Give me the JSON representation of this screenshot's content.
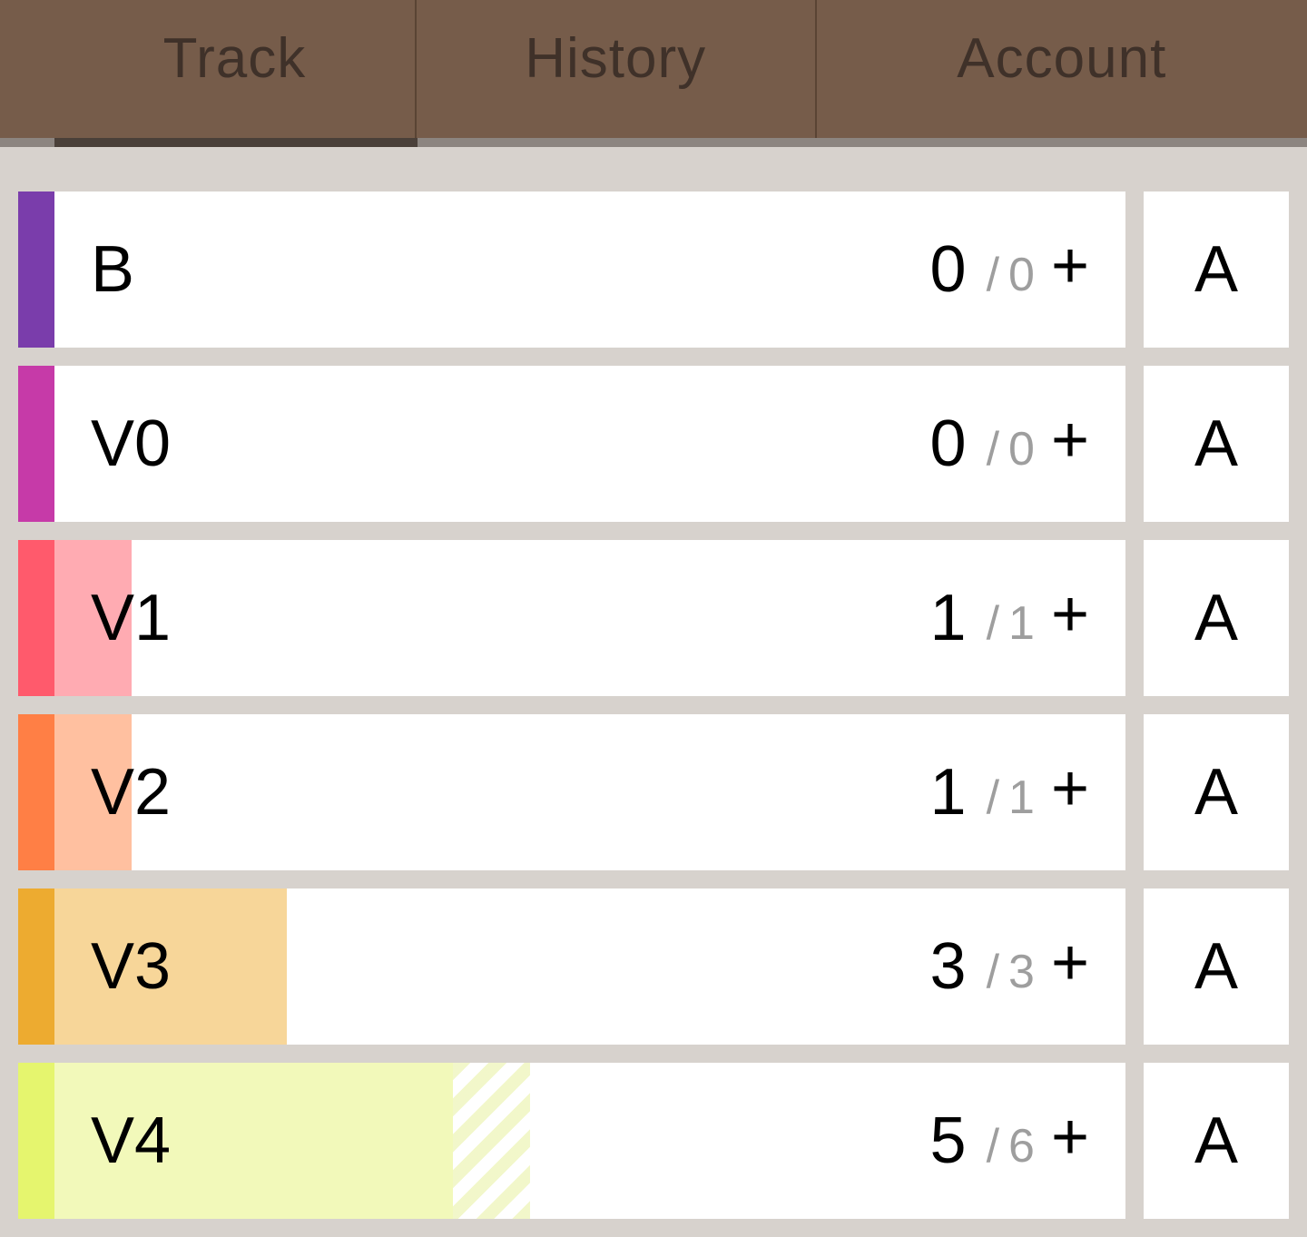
{
  "tabs": {
    "track": "Track",
    "history": "History",
    "account": "Account"
  },
  "colors": {
    "tab_bar": "#765c4a",
    "tab_text": "#3f3129",
    "background": "#d7d2cd"
  },
  "grades": [
    {
      "label": "B",
      "count": "0",
      "total": "0",
      "add": "+",
      "side": "A",
      "strip": "#7a3dab",
      "fill": "#c9a9e6",
      "progress": 0
    },
    {
      "label": "V0",
      "count": "0",
      "total": "0",
      "add": "+",
      "side": "A",
      "strip": "#c63aa8",
      "fill": "#eab0de",
      "progress": 0
    },
    {
      "label": "V1",
      "count": "1",
      "total": "1",
      "add": "+",
      "side": "A",
      "strip": "#ff5a6c",
      "fill": "#ffabb2",
      "progress": 0.07
    },
    {
      "label": "V2",
      "count": "1",
      "total": "1",
      "add": "+",
      "side": "A",
      "strip": "#ff7f45",
      "fill": "#ffc0a0",
      "progress": 0.07
    },
    {
      "label": "V3",
      "count": "3",
      "total": "3",
      "add": "+",
      "side": "A",
      "strip": "#edab30",
      "fill": "#f7d699",
      "progress": 0.21
    },
    {
      "label": "V4",
      "count": "5",
      "total": "6",
      "add": "+",
      "side": "A",
      "strip": "#e5f56e",
      "fill": "#f2f9ba",
      "progress": 0.36,
      "pending": 0.07
    }
  ]
}
